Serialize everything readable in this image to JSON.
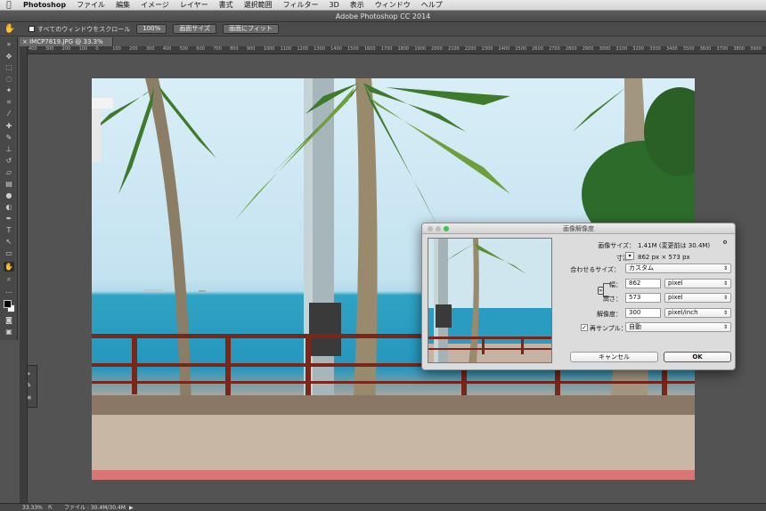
{
  "menubar": {
    "app_name": "Photoshop",
    "items": [
      "ファイル",
      "編集",
      "イメージ",
      "レイヤー",
      "書式",
      "選択範囲",
      "フィルター",
      "3D",
      "表示",
      "ウィンドウ",
      "ヘルプ"
    ]
  },
  "window": {
    "title": "Adobe Photoshop CC 2014"
  },
  "options_bar": {
    "scroll_all_label": "すべてのウィンドウをスクロール",
    "zoom_100_label": "100%",
    "fit_screen_label": "画面サイズ",
    "fill_screen_label": "画面にフィット"
  },
  "document": {
    "tab_label": "IMCP7819.JPG @ 33.3% (RGB/8)"
  },
  "ruler": {
    "labels": [
      "400",
      "300",
      "200",
      "100",
      "0",
      "100",
      "200",
      "300",
      "400",
      "500",
      "600",
      "700",
      "800",
      "900",
      "1000",
      "1100",
      "1200",
      "1300",
      "1400",
      "1500",
      "1600",
      "1700",
      "1800",
      "1900",
      "2000",
      "2100",
      "2200",
      "2300",
      "2400",
      "2500",
      "2600",
      "2700",
      "2800",
      "2900",
      "3000",
      "3100",
      "3200",
      "3300",
      "3400",
      "3500",
      "3600",
      "3700",
      "3800",
      "3900"
    ]
  },
  "status": {
    "zoom": "33.33%",
    "file_info": "ファイル : 30.4M/30.4M"
  },
  "dialog": {
    "title": "画像解像度",
    "image_size_label": "画像サイズ：",
    "image_size_value": "1.41M (変更前は 30.4M)",
    "dimensions_label": "寸法：",
    "dimensions_value": "862 px × 573 px",
    "fit_to_label": "合わせるサイズ：",
    "fit_to_value": "カスタム",
    "width_label": "幅：",
    "width_value": "862",
    "width_unit": "pixel",
    "height_label": "高さ：",
    "height_value": "573",
    "height_unit": "pixel",
    "resolution_label": "解像度：",
    "resolution_value": "300",
    "resolution_unit": "pixel/inch",
    "resample_label": "再サンプル：",
    "resample_checked": true,
    "resample_value": "自動",
    "cancel_label": "キャンセル",
    "ok_label": "OK"
  },
  "colors": {
    "app_bg": "#535353",
    "panel_bg": "#484848",
    "dialog_bg": "#dcdcdc",
    "close_red": "#fc605c",
    "min_yellow": "#fdbc40",
    "max_green": "#34c84a"
  },
  "icons": [
    "apple-icon",
    "hand-tool-icon",
    "move-tool-icon",
    "marquee-tool-icon",
    "lasso-tool-icon",
    "magic-wand-icon",
    "crop-tool-icon",
    "eyedropper-icon",
    "brush-tool-icon",
    "stamp-tool-icon",
    "eraser-tool-icon",
    "gradient-tool-icon",
    "pen-tool-icon",
    "type-tool-icon",
    "path-select-icon",
    "shape-tool-icon",
    "zoom-tool-icon",
    "gear-icon",
    "link-icon"
  ]
}
